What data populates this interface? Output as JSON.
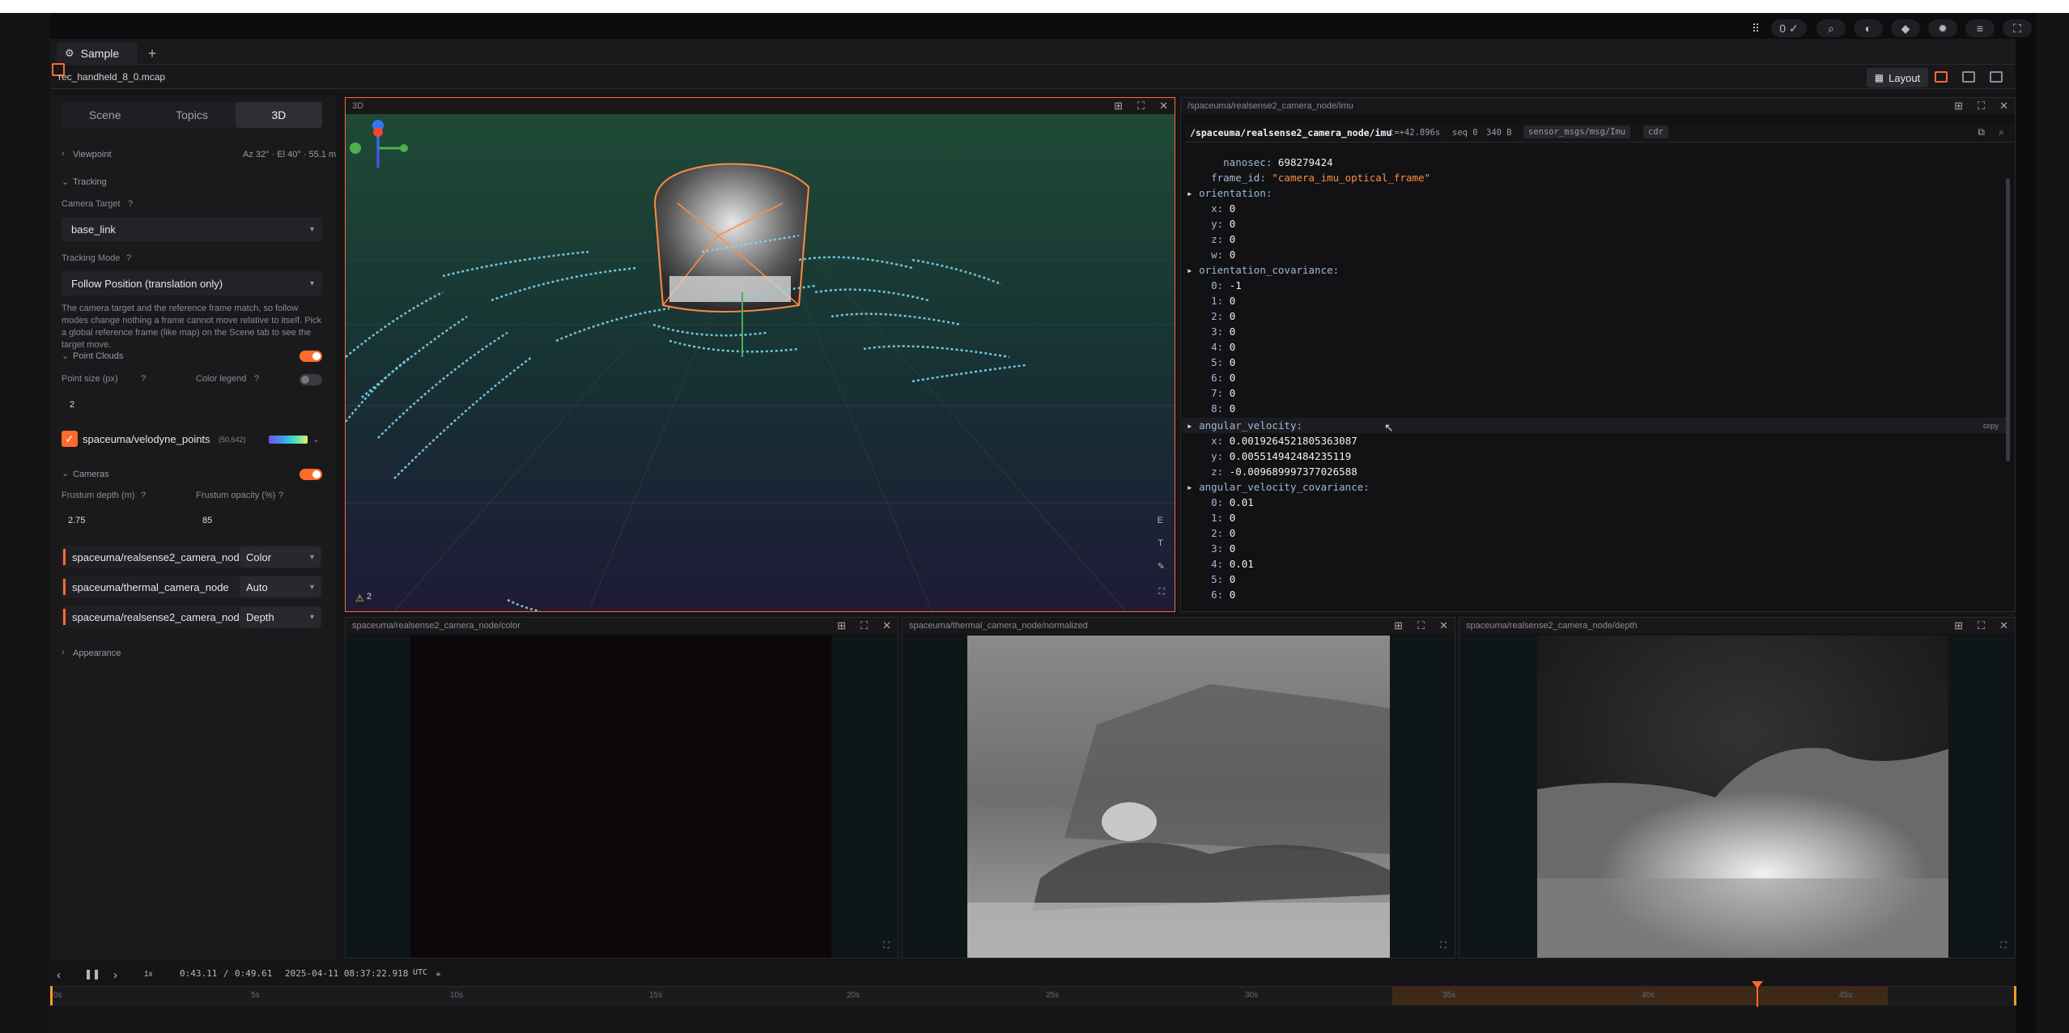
{
  "window": {
    "tab_title": "Sample",
    "new_tab": "+",
    "file_name": "rec_handheld_8_0.mcap",
    "layout_label": "Layout",
    "top_counter": "0 ✓"
  },
  "sidebar": {
    "tabs": [
      "Scene",
      "Topics",
      "3D"
    ],
    "viewpoint_label": "Viewpoint",
    "viewpoint_value": "Az 32° · El 40° · 55.1 m",
    "tracking_label": "Tracking",
    "camera_target_label": "Camera Target",
    "camera_target_value": "base_link",
    "tracking_mode_label": "Tracking Mode",
    "tracking_mode_value": "Follow Position (translation only)",
    "tracking_desc": "The camera target and the reference frame match, so follow modes change nothing a frame cannot move relative to itself. Pick a global reference frame (like map) on the Scene tab to see the target move.",
    "point_clouds_label": "Point Clouds",
    "point_size_label": "Point size (px)",
    "point_size_value": "2",
    "color_legend_label": "Color legend",
    "pc_topic": "spaceuma/velodyne_points",
    "pc_count": "(50,642)",
    "cameras_label": "Cameras",
    "frustum_depth_label": "Frustum depth (m)",
    "frustum_depth_value": "2.75",
    "frustum_opacity_label": "Frustum opacity (%)",
    "frustum_opacity_value": "85",
    "cameras": [
      {
        "name": "spaceuma/realsense2_camera_node",
        "mode": "Color"
      },
      {
        "name": "spaceuma/thermal_camera_node",
        "mode": "Auto"
      },
      {
        "name": "spaceuma/realsense2_camera_node",
        "mode": "Depth"
      }
    ],
    "appearance_label": "Appearance"
  },
  "panels": {
    "view3d_title": "3D",
    "view3d_warning": "2",
    "view3d_side_buttons": [
      "E",
      "T"
    ],
    "imu_title": "/spaceuma/realsense2_camera_node/imu",
    "color_title": "spaceuma/realsense2_camera_node/color",
    "thermal_title": "spaceuma/thermal_camera_node/normalized",
    "depth_title": "spaceuma/realsense2_camera_node/depth"
  },
  "imu": {
    "topic": "/spaceuma/realsense2_camera_node/imu",
    "time": "t=+42.896s",
    "seq": "seq 0",
    "size": "340 B",
    "type": "sensor_msgs/msg/Imu",
    "enc": "cdr",
    "copy_label": "copy",
    "nanosec": "698279424",
    "frame_id": "\"camera_imu_optical_frame\"",
    "orientation": {
      "x": "0",
      "y": "0",
      "z": "0",
      "w": "0"
    },
    "orientation_covariance": [
      "-1",
      "0",
      "0",
      "0",
      "0",
      "0",
      "0",
      "0",
      "0"
    ],
    "angular_velocity": {
      "x": "0.0019264521805363087",
      "y": "0.005514942484235119",
      "z": "-0.009689997377026588"
    },
    "angular_velocity_covariance": [
      "0.01",
      "0",
      "0",
      "0",
      "0.01",
      "0",
      "0"
    ]
  },
  "timeline": {
    "current": "0:43.11",
    "total": "0:49.61",
    "separator": "/",
    "datetime": "2025-04-11 08:37:22.918",
    "tz": "UTC",
    "speed": "1x",
    "ticks": [
      "0s",
      "5s",
      "10s",
      "15s",
      "20s",
      "25s",
      "30s",
      "35s",
      "40s",
      "45s"
    ]
  },
  "colors": {
    "accent": "#ff6b2b",
    "panel_bg": "#121214",
    "cloud": "#7fd4f0"
  }
}
